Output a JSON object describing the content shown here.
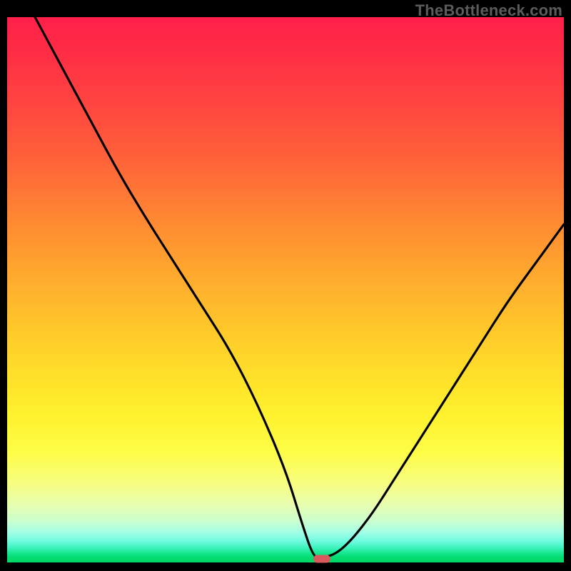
{
  "watermark": "TheBottleneck.com",
  "colors": {
    "background": "#000000",
    "curve_stroke": "#000000",
    "marker_fill": "#d95a5c",
    "watermark_color": "#5b5b5b"
  },
  "marker": {
    "x_fraction": 0.565,
    "y_fraction": 0.993
  },
  "chart_data": {
    "type": "line",
    "title": "",
    "xlabel": "",
    "ylabel": "",
    "xlim": [
      0,
      100
    ],
    "ylim": [
      0,
      100
    ],
    "grid": false,
    "legend": false,
    "series": [
      {
        "name": "bottleneck-curve",
        "x": [
          5,
          10,
          15,
          20,
          25,
          30,
          35,
          40,
          45,
          50,
          53,
          55,
          56.5,
          60,
          65,
          70,
          75,
          80,
          85,
          90,
          95,
          100
        ],
        "y": [
          100,
          90.5,
          81,
          71.5,
          63,
          55,
          47,
          39,
          29,
          17,
          7,
          1,
          0.7,
          2,
          8,
          16,
          24,
          32,
          40,
          48,
          55,
          62
        ]
      }
    ],
    "annotations": [
      {
        "type": "marker",
        "x": 56.5,
        "y": 0.7,
        "shape": "pill",
        "color": "#d95a5c"
      }
    ],
    "background_gradient": {
      "direction": "vertical",
      "stops": [
        {
          "pos": 0.0,
          "color": "#ff1f4a"
        },
        {
          "pos": 0.5,
          "color": "#ffb12d"
        },
        {
          "pos": 0.8,
          "color": "#fdfd47"
        },
        {
          "pos": 0.95,
          "color": "#72fbe1"
        },
        {
          "pos": 1.0,
          "color": "#00d865"
        }
      ]
    }
  }
}
